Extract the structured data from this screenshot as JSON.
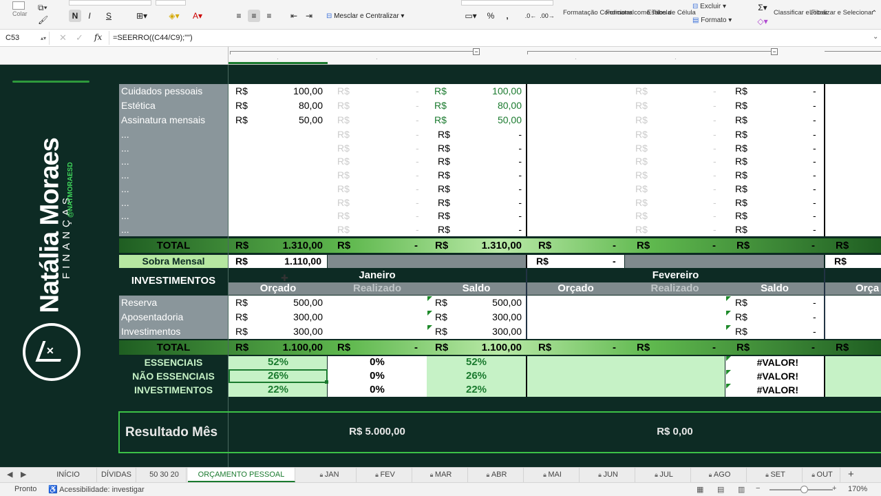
{
  "ribbon": {
    "paste_label": "Colar",
    "bold_label": "N",
    "strike_label": "S",
    "merge_label": "Mesclar e Centralizar",
    "percent_label": "%",
    "comma_label": ",",
    "cond_format_label": "Formatação Condicional",
    "format_table_label": "Formatar como Tabela",
    "cell_styles_label": "Estilos de Célula",
    "delete_label": "Excluir",
    "format_label": "Formato",
    "sort_filter_label": "Classificar e Filtrar",
    "find_select_label": "Localizar e Selecionar"
  },
  "formula_bar": {
    "cell_ref": "C53",
    "fx": "fx",
    "formula": "=SEERRO((C44/C9);\"\")"
  },
  "brand": {
    "name": "Natália Moraes",
    "sub": "FINANÇAS",
    "handle": "@NATMORAESD"
  },
  "currency": "R$",
  "dash": "-",
  "expenses": [
    {
      "label": "Cuidados pessoais",
      "orcado": "100,00",
      "saldo": "100,00"
    },
    {
      "label": "Estética",
      "orcado": "80,00",
      "saldo": "80,00"
    },
    {
      "label": "Assinatura mensais",
      "orcado": "50,00",
      "saldo": "50,00"
    },
    {
      "label": "...",
      "orcado": "",
      "saldo": "-"
    },
    {
      "label": "...",
      "orcado": "",
      "saldo": "-"
    },
    {
      "label": "...",
      "orcado": "",
      "saldo": "-"
    },
    {
      "label": "...",
      "orcado": "",
      "saldo": "-"
    },
    {
      "label": "...",
      "orcado": "",
      "saldo": "-"
    },
    {
      "label": "...",
      "orcado": "",
      "saldo": "-"
    },
    {
      "label": "...",
      "orcado": "",
      "saldo": "-"
    },
    {
      "label": "...",
      "orcado": "",
      "saldo": "-"
    }
  ],
  "total_label": "TOTAL",
  "total1": {
    "orcado": "1.310,00",
    "realizado": "-",
    "saldo": "1.310,00",
    "fev_orcado": "-",
    "fev_realizado": "-",
    "fev_saldo": "-"
  },
  "sobra": {
    "label": "Sobra Mensal",
    "jan": "1.110,00",
    "fev": "-"
  },
  "investments": {
    "title": "INVESTIMENTOS",
    "months": [
      "Janeiro",
      "Fevereiro"
    ],
    "cols": [
      "Orçado",
      "Realizado",
      "Saldo"
    ],
    "next_col": "Orça",
    "rows": [
      {
        "label": "Reserva",
        "orcado": "500,00",
        "saldo": "500,00"
      },
      {
        "label": "Aposentadoria",
        "orcado": "300,00",
        "saldo": "300,00"
      },
      {
        "label": "Investimentos",
        "orcado": "300,00",
        "saldo": "300,00"
      }
    ]
  },
  "total2": {
    "orcado": "1.100,00",
    "realizado": "-",
    "saldo": "1.100,00",
    "fev_orcado": "-",
    "fev_realizado": "-",
    "fev_saldo": "-"
  },
  "percentages": [
    {
      "label": "ESSENCIAIS",
      "orcado": "52%",
      "realizado": "0%",
      "saldo": "52%",
      "fev_saldo": "#VALOR!"
    },
    {
      "label": "NÃO ESSENCIAIS",
      "orcado": "26%",
      "realizado": "0%",
      "saldo": "26%",
      "fev_saldo": "#VALOR!"
    },
    {
      "label": "INVESTIMENTOS",
      "orcado": "22%",
      "realizado": "0%",
      "saldo": "22%",
      "fev_saldo": "#VALOR!"
    }
  ],
  "result": {
    "label": "Resultado Mês",
    "jan": "R$ 5.000,00",
    "fev": "R$ 0,00"
  },
  "tabs": [
    "INÍCIO",
    "DÍVIDAS",
    "50 30 20",
    "ORÇAMENTO PESSOAL",
    "JAN",
    "FEV",
    "MAR",
    "ABR",
    "MAI",
    "JUN",
    "JUL",
    "AGO",
    "SET",
    "OUT"
  ],
  "status": {
    "ready": "Pronto",
    "accessibility": "Acessibilidade: investigar",
    "zoom": "170%"
  },
  "colors": {
    "sheet_bg": "#0d2b24",
    "accent_green": "#1a7a2e",
    "pct_bg": "#c6f2c6"
  }
}
